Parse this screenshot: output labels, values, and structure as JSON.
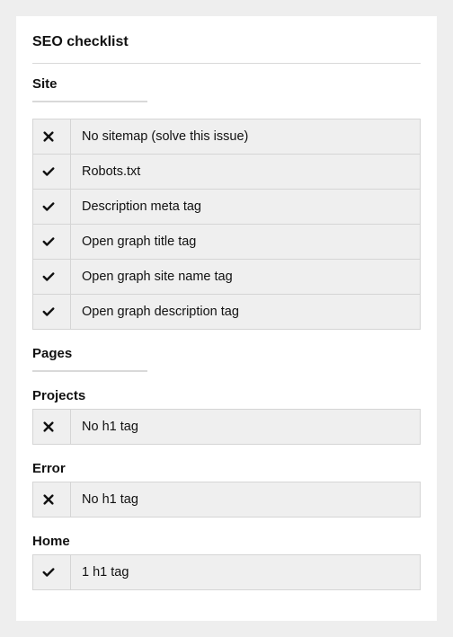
{
  "title": "SEO checklist",
  "sections": {
    "site": {
      "heading": "Site",
      "items": [
        {
          "status": "fail",
          "text": "No sitemap (solve this issue)"
        },
        {
          "status": "pass",
          "text": "Robots.txt"
        },
        {
          "status": "pass",
          "text": "Description meta tag"
        },
        {
          "status": "pass",
          "text": "Open graph title tag"
        },
        {
          "status": "pass",
          "text": "Open graph site name tag"
        },
        {
          "status": "pass",
          "text": "Open graph description tag"
        }
      ]
    },
    "pages": {
      "heading": "Pages",
      "groups": [
        {
          "name": "Projects",
          "items": [
            {
              "status": "fail",
              "text": "No h1 tag"
            }
          ]
        },
        {
          "name": "Error",
          "items": [
            {
              "status": "fail",
              "text": "No h1 tag"
            }
          ]
        },
        {
          "name": "Home",
          "items": [
            {
              "status": "pass",
              "text": "1 h1 tag"
            }
          ]
        }
      ]
    }
  }
}
